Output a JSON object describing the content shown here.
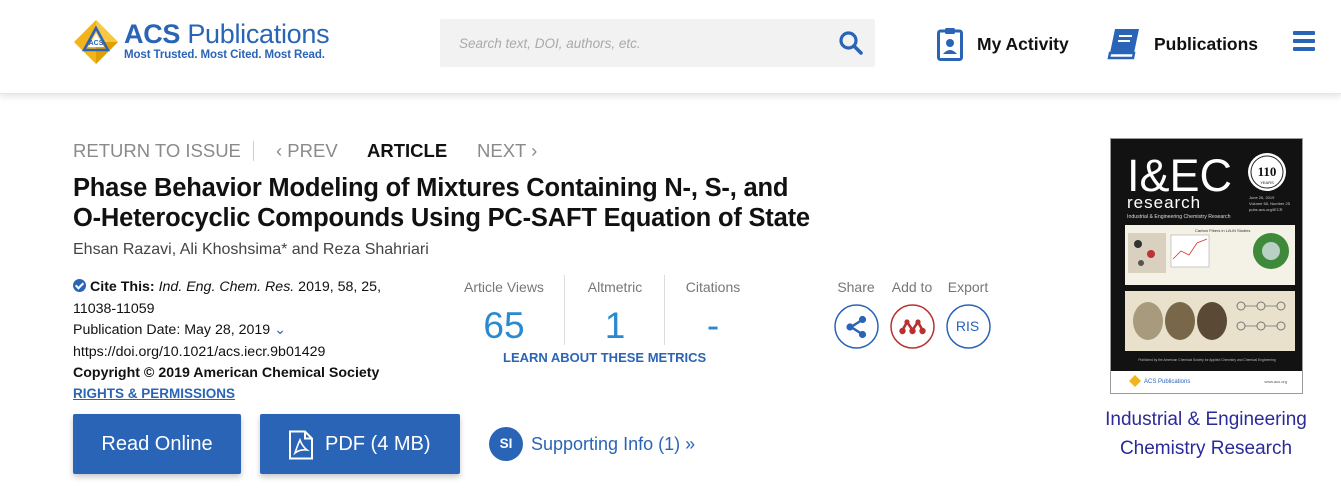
{
  "brand": {
    "name_part1": "ACS",
    "name_part2": "Publications",
    "tagline": "Most Trusted. Most Cited. Most Read.",
    "logo_mark_text": "ACS",
    "color": "#2a64b7"
  },
  "search": {
    "placeholder": "Search text, DOI, authors, etc.",
    "icon": "search-icon"
  },
  "header_links": {
    "my_activity": "My Activity",
    "publications": "Publications",
    "menu_icon": "hamburger-menu-icon"
  },
  "article_nav": {
    "return": "RETURN TO ISSUE",
    "prev": "‹ PREV",
    "article": "ARTICLE",
    "next": "NEXT ›"
  },
  "article": {
    "title_line1": "Phase Behavior Modeling of Mixtures Containing N-, S-, and",
    "title_line2": "O-Heterocyclic Compounds Using PC-SAFT Equation of State",
    "authors": "Ehsan Razavi, Ali Khoshsima* and Reza Shahriari"
  },
  "citation": {
    "cite_label": "Cite This:",
    "journal_abbrev": "Ind. Eng. Chem. Res.",
    "cite_rest": " 2019, 58, 25, 11038-11059",
    "publication_date": "Publication Date: May 28, 2019",
    "date_chevron": "⌄",
    "doi_url": "https://doi.org/10.1021/acs.iecr.9b01429",
    "copyright": "Copyright © 2019 American Chemical Society",
    "rights": "RIGHTS & PERMISSIONS"
  },
  "metrics": {
    "views_label": "Article Views",
    "views_value": "65",
    "altmetric_label": "Altmetric",
    "altmetric_value": "1",
    "citations_label": "Citations",
    "citations_value": "-",
    "learn_more": "LEARN ABOUT THESE METRICS"
  },
  "tools": {
    "share_label": "Share",
    "add_to_label": "Add to",
    "export_label": "Export",
    "export_button": "RIS"
  },
  "actions": {
    "read_online": "Read Online",
    "pdf": "PDF (4 MB)",
    "si_badge": "SI",
    "supporting_info": "Supporting Info (1) »"
  },
  "journal": {
    "name_line1": "Industrial & Engineering",
    "name_line2": "Chemistry Research",
    "cover_title": "I&EC",
    "cover_subtitle": "research",
    "cover_tagline": "Industrial & Engineering Chemistry Research",
    "cover_anniversary": "110",
    "cover_anniversary_label": "YEARS",
    "cover_date": "June 26, 2019",
    "cover_volume": "Volume 58, Number 25",
    "cover_url": "pubs.acs.org/IECR",
    "cover_feature_heading": "Carbon Fibers in Li/LiN Studies",
    "cover_footer": "Published by the American Chemical Society for Applied Chemistry and Chemical Engineering",
    "cover_publisher": "ACS Publications",
    "cover_publisher_url": "www.acs.org"
  }
}
